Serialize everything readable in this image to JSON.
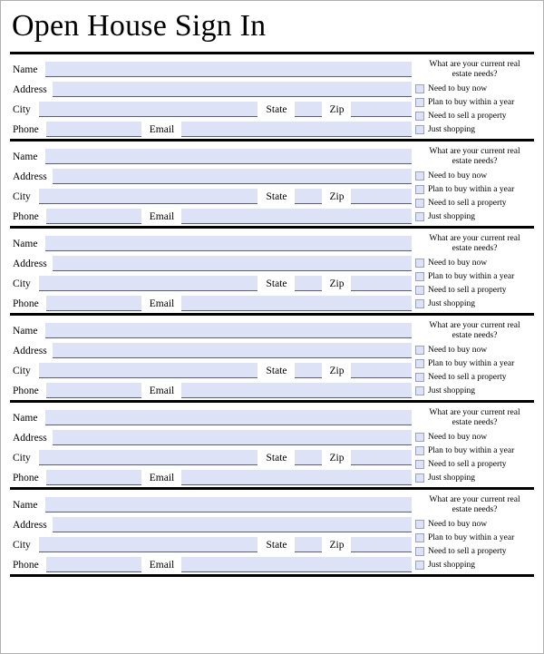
{
  "document": {
    "title": "Open House Sign In"
  },
  "form": {
    "field_labels": {
      "name": "Name",
      "address": "Address",
      "city": "City",
      "state": "State",
      "zip": "Zip",
      "phone": "Phone",
      "email": "Email"
    },
    "field_values": {
      "name": "",
      "address": "",
      "city": "",
      "state": "",
      "zip": "",
      "phone": "",
      "email": ""
    },
    "needs": {
      "question": "What are your current real estate needs?",
      "options": [
        {
          "label": "Need to buy now",
          "checked": false
        },
        {
          "label": "Plan to buy within a year",
          "checked": false
        },
        {
          "label": "Need to sell a property",
          "checked": false
        },
        {
          "label": "Just shopping",
          "checked": false
        }
      ]
    },
    "entry_count": 6
  },
  "colors": {
    "field_fill": "#dde2f7",
    "field_underline": "#5a5f73",
    "divider": "#000000",
    "checkbox_border": "#9aa2c2",
    "page_border": "#b0b0b0",
    "text": "#000000"
  }
}
